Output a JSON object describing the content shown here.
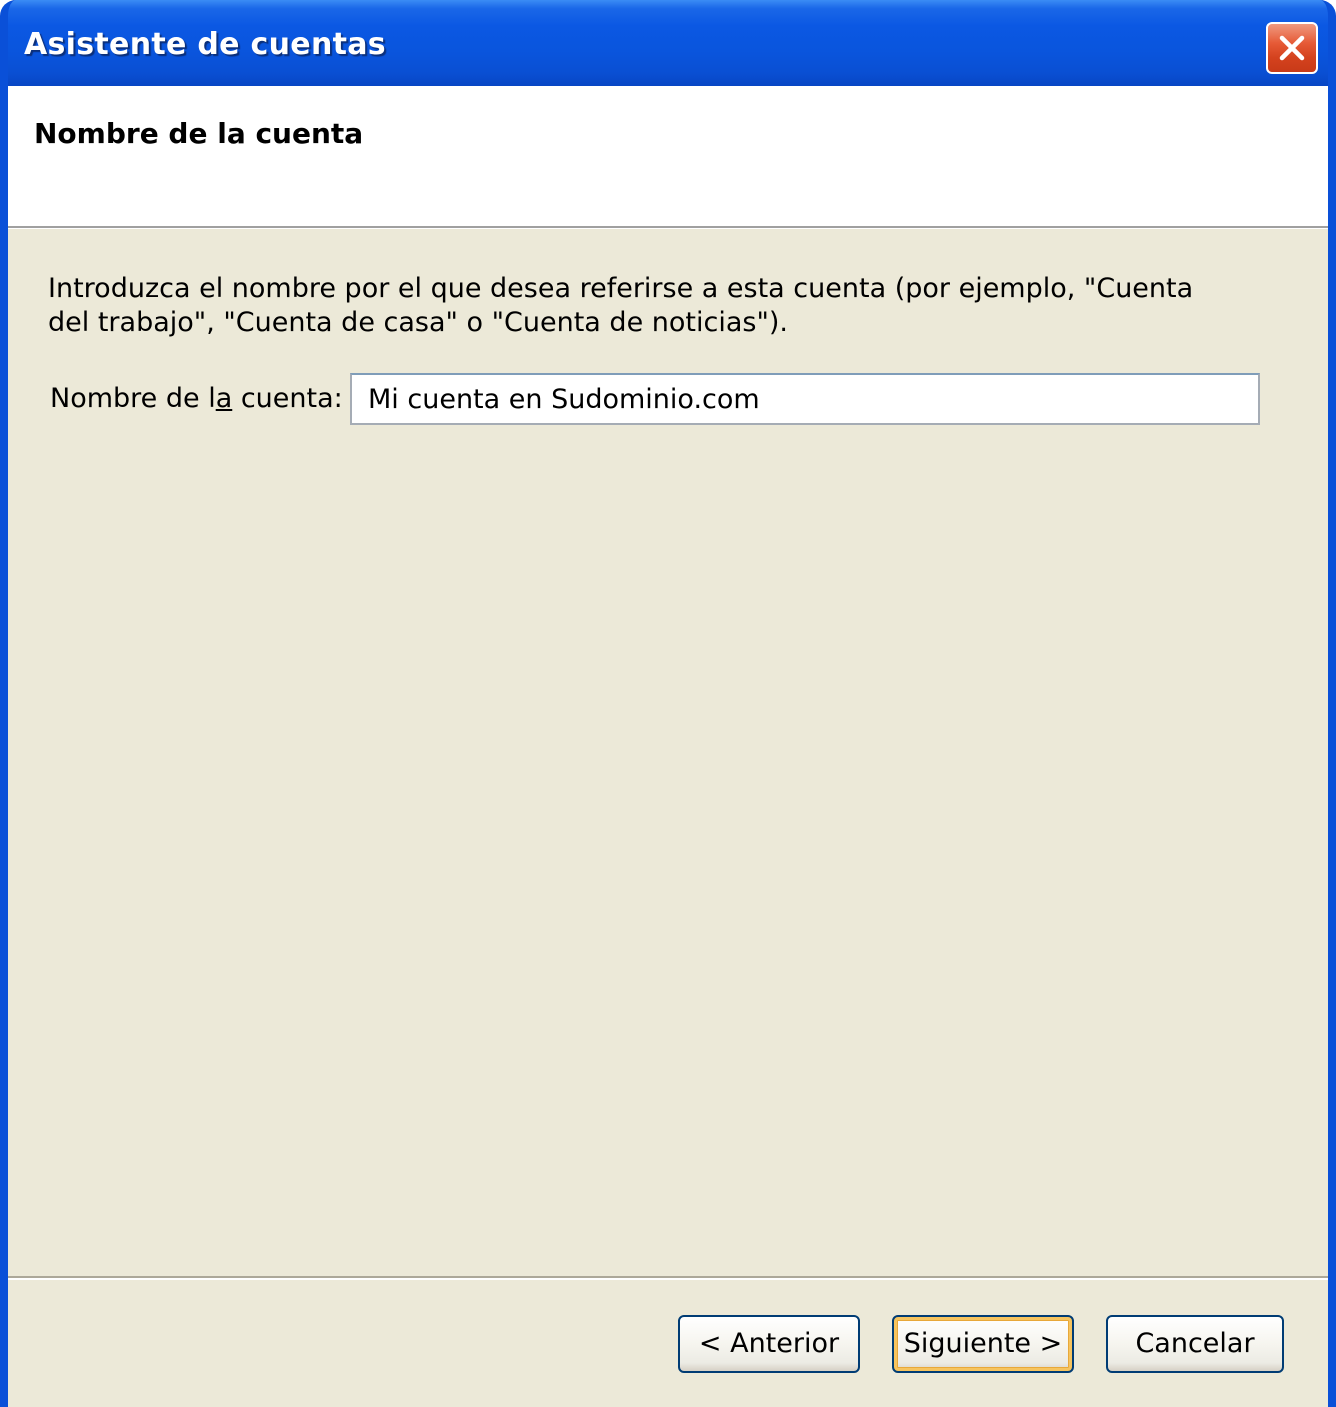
{
  "window": {
    "title": "Asistente de cuentas"
  },
  "titlebar": {
    "close_icon": "close-icon"
  },
  "header": {
    "title": "Nombre de la cuenta"
  },
  "body": {
    "description": "Introduzca el nombre por el que desea referirse a esta cuenta (por ejemplo, \"Cuenta del trabajo\", \"Cuenta de casa\" o \"Cuenta de noticias\").",
    "field_label_before": "Nombre de l",
    "field_label_accel": "a",
    "field_label_after": " cuenta:",
    "account_name_value": "Mi cuenta en Sudominio.com"
  },
  "buttons": {
    "previous": "< Anterior",
    "next": "Siguiente >",
    "cancel": "Cancelar"
  },
  "colors": {
    "titlebar_blue": "#0a50d8",
    "dialog_background": "#ece9d8",
    "close_button_red": "#e65a36",
    "default_button_highlight": "#f6c45f"
  }
}
